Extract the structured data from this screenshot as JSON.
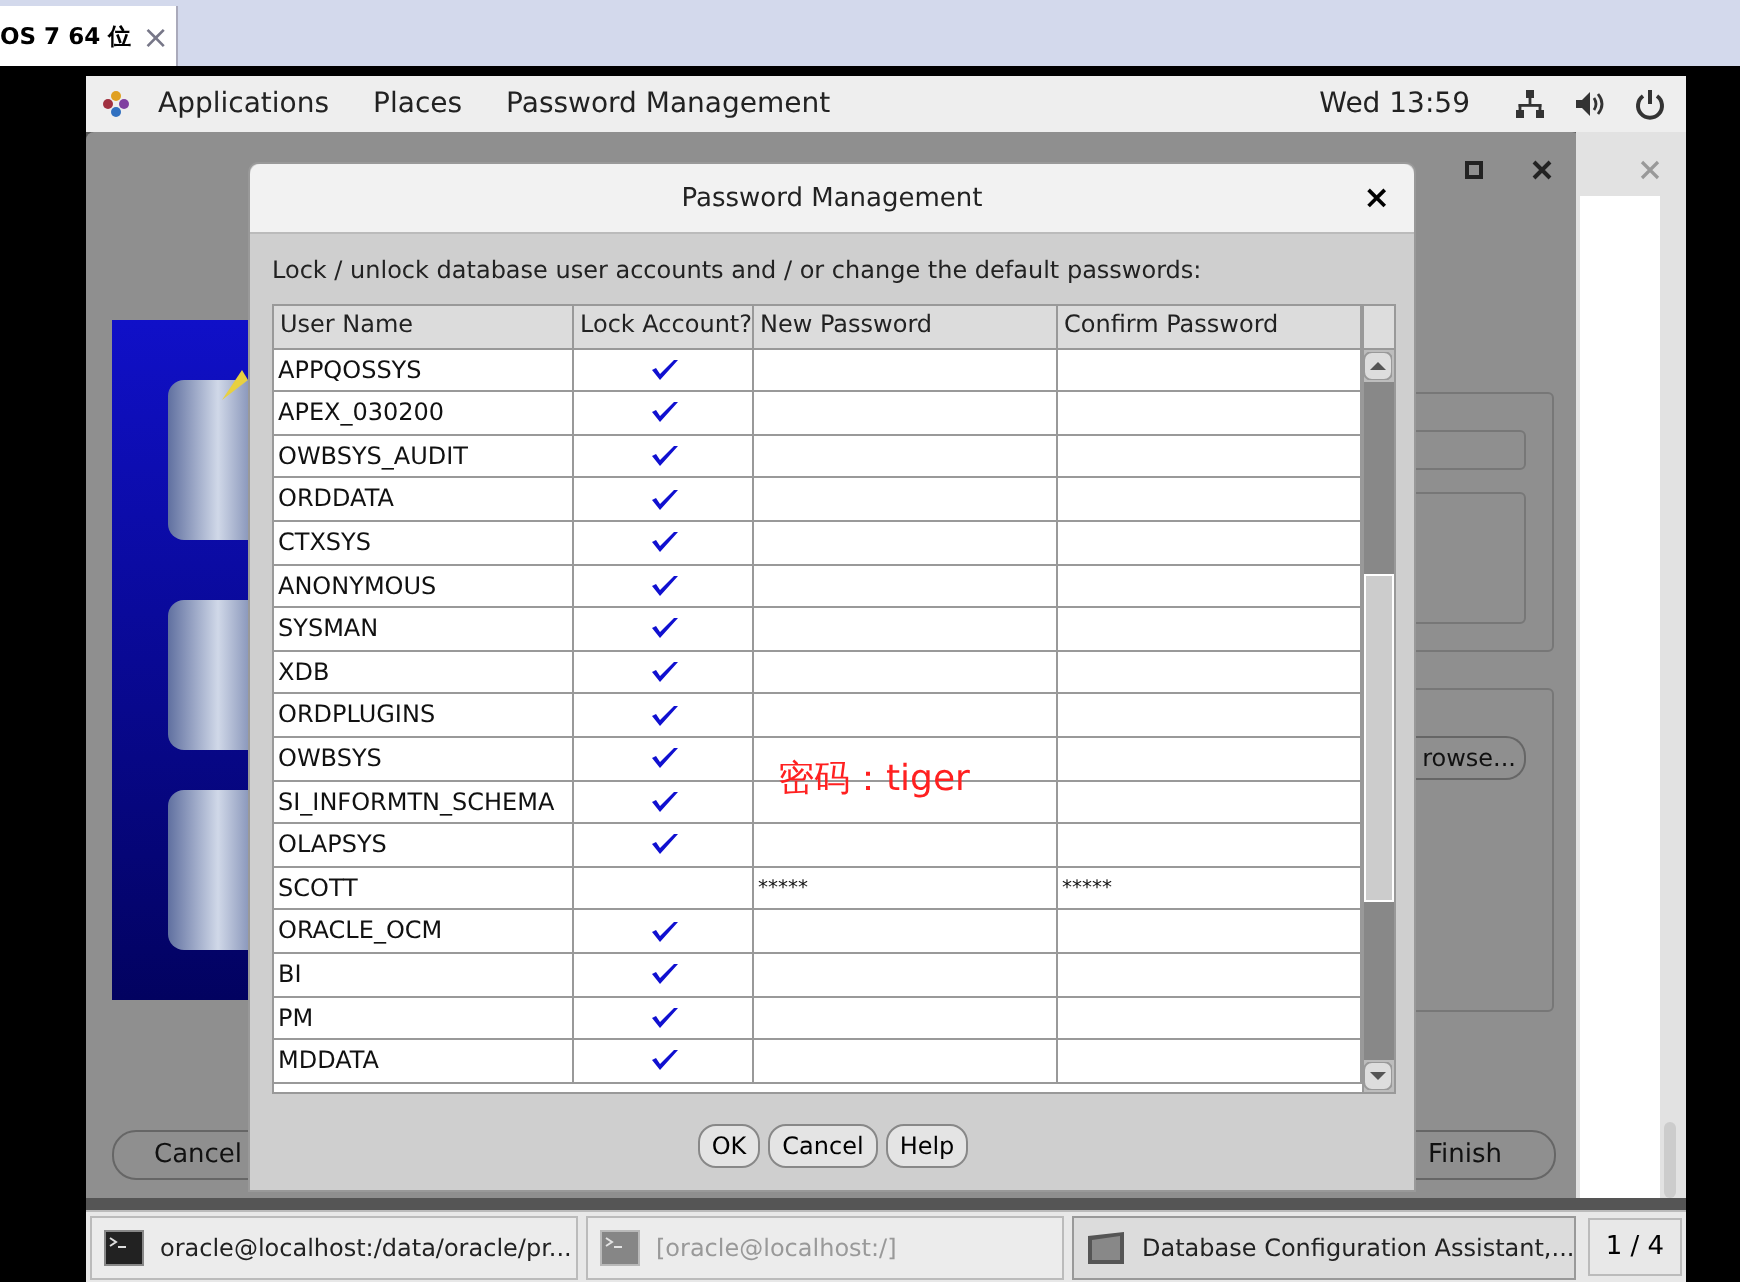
{
  "browser_tab": {
    "label": "OS 7 64 位",
    "close": "×"
  },
  "top_bar": {
    "menus": [
      "Applications",
      "Places",
      "Password Management"
    ],
    "clock": "Wed 13:59"
  },
  "background_window": {
    "buttons": [
      {
        "label": "Cancel"
      },
      {
        "label": "Finish"
      },
      {
        "label": "rowse..."
      }
    ]
  },
  "dialog": {
    "title": "Password Management",
    "close": "×",
    "instructions": "Lock / unlock database user accounts and / or change the default passwords:",
    "table": {
      "columns": [
        "User Name",
        "Lock Account?",
        "New Password",
        "Confirm Password"
      ],
      "rows": [
        {
          "user": "APPQOSSYS",
          "locked": true,
          "new_password": "",
          "confirm_password": ""
        },
        {
          "user": "APEX_030200",
          "locked": true,
          "new_password": "",
          "confirm_password": ""
        },
        {
          "user": "OWBSYS_AUDIT",
          "locked": true,
          "new_password": "",
          "confirm_password": ""
        },
        {
          "user": "ORDDATA",
          "locked": true,
          "new_password": "",
          "confirm_password": ""
        },
        {
          "user": "CTXSYS",
          "locked": true,
          "new_password": "",
          "confirm_password": ""
        },
        {
          "user": "ANONYMOUS",
          "locked": true,
          "new_password": "",
          "confirm_password": ""
        },
        {
          "user": "SYSMAN",
          "locked": true,
          "new_password": "",
          "confirm_password": ""
        },
        {
          "user": "XDB",
          "locked": true,
          "new_password": "",
          "confirm_password": ""
        },
        {
          "user": "ORDPLUGINS",
          "locked": true,
          "new_password": "",
          "confirm_password": ""
        },
        {
          "user": "OWBSYS",
          "locked": true,
          "new_password": "",
          "confirm_password": ""
        },
        {
          "user": "SI_INFORMTN_SCHEMA",
          "locked": true,
          "new_password": "",
          "confirm_password": ""
        },
        {
          "user": "OLAPSYS",
          "locked": true,
          "new_password": "",
          "confirm_password": ""
        },
        {
          "user": "SCOTT",
          "locked": false,
          "new_password": "*****",
          "confirm_password": "*****"
        },
        {
          "user": "ORACLE_OCM",
          "locked": true,
          "new_password": "",
          "confirm_password": ""
        },
        {
          "user": "BI",
          "locked": true,
          "new_password": "",
          "confirm_password": ""
        },
        {
          "user": "PM",
          "locked": true,
          "new_password": "",
          "confirm_password": ""
        },
        {
          "user": "MDDATA",
          "locked": true,
          "new_password": "",
          "confirm_password": ""
        }
      ]
    },
    "annotation": "密码：tiger",
    "buttons": [
      "OK",
      "Cancel",
      "Help"
    ]
  },
  "taskbar": {
    "items": [
      {
        "label": "oracle@localhost:/data/oracle/pr...",
        "selected": false,
        "kind": "terminal"
      },
      {
        "label": "[oracle@localhost:/]",
        "selected": false,
        "kind": "terminal-dim"
      },
      {
        "label": "Database Configuration Assistant,...",
        "selected": true,
        "kind": "app"
      }
    ],
    "workspace": "1 / 4"
  }
}
